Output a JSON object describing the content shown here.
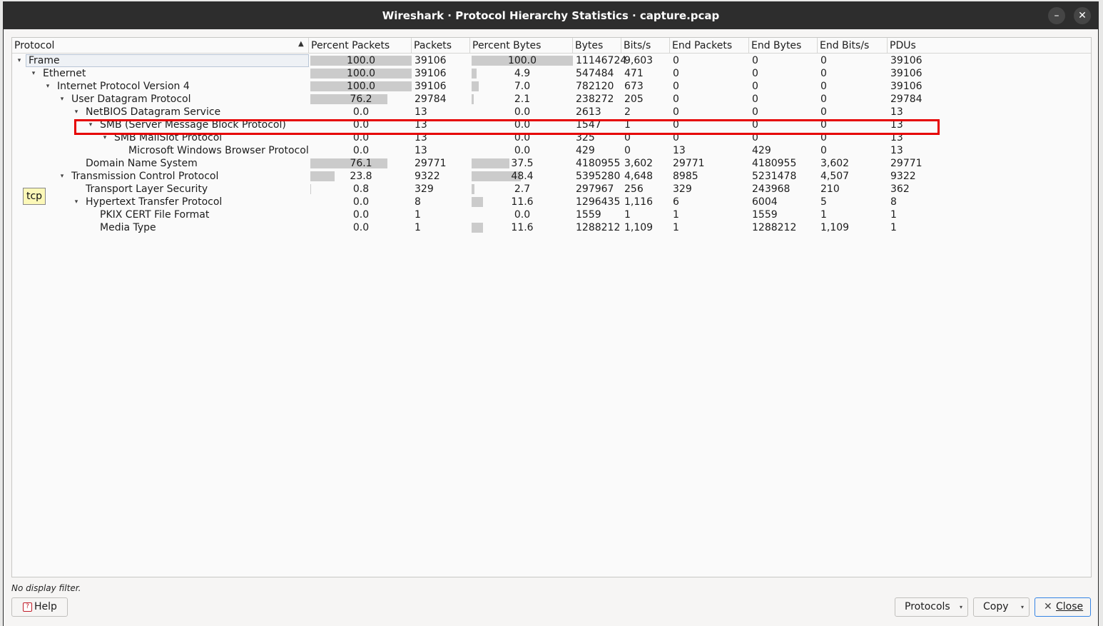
{
  "window": {
    "title": "Wireshark · Protocol Hierarchy Statistics · capture.pcap",
    "minimize_glyph": "–",
    "close_glyph": "✕"
  },
  "columns": [
    "Protocol",
    "Percent Packets",
    "Packets",
    "Percent Bytes",
    "Bytes",
    "Bits/s",
    "End Packets",
    "End Bytes",
    "End Bits/s",
    "PDUs"
  ],
  "sort_glyph": "▲",
  "rows": [
    {
      "level": 0,
      "expand": "▾",
      "protocol": "Frame",
      "pct_packets": "100.0",
      "pct_packets_value": 100.0,
      "packets": "39106",
      "pct_bytes": "100.0",
      "pct_bytes_value": 100.0,
      "bytes": "11146724",
      "bits_s": "9,603",
      "end_packets": "0",
      "end_bytes": "0",
      "end_bits_s": "0",
      "pdus": "39106"
    },
    {
      "level": 1,
      "expand": "▾",
      "protocol": "Ethernet",
      "pct_packets": "100.0",
      "pct_packets_value": 100.0,
      "packets": "39106",
      "pct_bytes": "4.9",
      "pct_bytes_value": 4.9,
      "bytes": "547484",
      "bits_s": "471",
      "end_packets": "0",
      "end_bytes": "0",
      "end_bits_s": "0",
      "pdus": "39106"
    },
    {
      "level": 2,
      "expand": "▾",
      "protocol": "Internet Protocol Version 4",
      "pct_packets": "100.0",
      "pct_packets_value": 100.0,
      "packets": "39106",
      "pct_bytes": "7.0",
      "pct_bytes_value": 7.0,
      "bytes": "782120",
      "bits_s": "673",
      "end_packets": "0",
      "end_bytes": "0",
      "end_bits_s": "0",
      "pdus": "39106"
    },
    {
      "level": 3,
      "expand": "▾",
      "protocol": "User Datagram Protocol",
      "pct_packets": "76.2",
      "pct_packets_value": 76.2,
      "packets": "29784",
      "pct_bytes": "2.1",
      "pct_bytes_value": 2.1,
      "bytes": "238272",
      "bits_s": "205",
      "end_packets": "0",
      "end_bytes": "0",
      "end_bits_s": "0",
      "pdus": "29784"
    },
    {
      "level": 4,
      "expand": "▾",
      "protocol": "NetBIOS Datagram Service",
      "pct_packets": "0.0",
      "pct_packets_value": 0.0,
      "packets": "13",
      "pct_bytes": "0.0",
      "pct_bytes_value": 0.0,
      "bytes": "2613",
      "bits_s": "2",
      "end_packets": "0",
      "end_bytes": "0",
      "end_bits_s": "0",
      "pdus": "13"
    },
    {
      "level": 5,
      "expand": "▾",
      "protocol": "SMB (Server Message Block Protocol)",
      "pct_packets": "0.0",
      "pct_packets_value": 0.0,
      "packets": "13",
      "pct_bytes": "0.0",
      "pct_bytes_value": 0.0,
      "bytes": "1547",
      "bits_s": "1",
      "end_packets": "0",
      "end_bytes": "0",
      "end_bits_s": "0",
      "pdus": "13"
    },
    {
      "level": 6,
      "expand": "▾",
      "protocol": "SMB MailSlot Protocol",
      "pct_packets": "0.0",
      "pct_packets_value": 0.0,
      "packets": "13",
      "pct_bytes": "0.0",
      "pct_bytes_value": 0.0,
      "bytes": "325",
      "bits_s": "0",
      "end_packets": "0",
      "end_bytes": "0",
      "end_bits_s": "0",
      "pdus": "13"
    },
    {
      "level": 7,
      "expand": "",
      "protocol": "Microsoft Windows Browser Protocol",
      "pct_packets": "0.0",
      "pct_packets_value": 0.0,
      "packets": "13",
      "pct_bytes": "0.0",
      "pct_bytes_value": 0.0,
      "bytes": "429",
      "bits_s": "0",
      "end_packets": "13",
      "end_bytes": "429",
      "end_bits_s": "0",
      "pdus": "13"
    },
    {
      "level": 4,
      "expand": "",
      "protocol": "Domain Name System",
      "pct_packets": "76.1",
      "pct_packets_value": 76.1,
      "packets": "29771",
      "pct_bytes": "37.5",
      "pct_bytes_value": 37.5,
      "bytes": "4180955",
      "bits_s": "3,602",
      "end_packets": "29771",
      "end_bytes": "4180955",
      "end_bits_s": "3,602",
      "pdus": "29771"
    },
    {
      "level": 3,
      "expand": "▾",
      "protocol": "Transmission Control Protocol",
      "pct_packets": "23.8",
      "pct_packets_value": 23.8,
      "packets": "9322",
      "pct_bytes": "48.4",
      "pct_bytes_value": 48.4,
      "bytes": "5395280",
      "bits_s": "4,648",
      "end_packets": "8985",
      "end_bytes": "5231478",
      "end_bits_s": "4,507",
      "pdus": "9322"
    },
    {
      "level": 4,
      "expand": "",
      "protocol": "Transport Layer Security",
      "pct_packets": "0.8",
      "pct_packets_value": 0.8,
      "packets": "329",
      "pct_bytes": "2.7",
      "pct_bytes_value": 2.7,
      "bytes": "297967",
      "bits_s": "256",
      "end_packets": "329",
      "end_bytes": "243968",
      "end_bits_s": "210",
      "pdus": "362"
    },
    {
      "level": 4,
      "expand": "▾",
      "protocol": "Hypertext Transfer Protocol",
      "pct_packets": "0.0",
      "pct_packets_value": 0.0,
      "packets": "8",
      "pct_bytes": "11.6",
      "pct_bytes_value": 11.6,
      "bytes": "1296435",
      "bits_s": "1,116",
      "end_packets": "6",
      "end_bytes": "6004",
      "end_bits_s": "5",
      "pdus": "8"
    },
    {
      "level": 5,
      "expand": "",
      "protocol": "PKIX CERT File Format",
      "pct_packets": "0.0",
      "pct_packets_value": 0.0,
      "packets": "1",
      "pct_bytes": "0.0",
      "pct_bytes_value": 0.0,
      "bytes": "1559",
      "bits_s": "1",
      "end_packets": "1",
      "end_bytes": "1559",
      "end_bits_s": "1",
      "pdus": "1"
    },
    {
      "level": 5,
      "expand": "",
      "protocol": "Media Type",
      "pct_packets": "0.0",
      "pct_packets_value": 0.0,
      "packets": "1",
      "pct_bytes": "11.6",
      "pct_bytes_value": 11.6,
      "bytes": "1288212",
      "bits_s": "1,109",
      "end_packets": "1",
      "end_bytes": "1288212",
      "end_bits_s": "1,109",
      "pdus": "1"
    }
  ],
  "selected_row": 0,
  "highlighted_row": 8,
  "highlight_color": "#e60000",
  "tooltip": "tcp",
  "status": "No display filter.",
  "buttons": {
    "help": "Help",
    "help_icon": "?",
    "protocols": "Protocols",
    "copy": "Copy",
    "close": "Close",
    "dropdown_glyph": "▾",
    "close_glyph": "✕"
  }
}
